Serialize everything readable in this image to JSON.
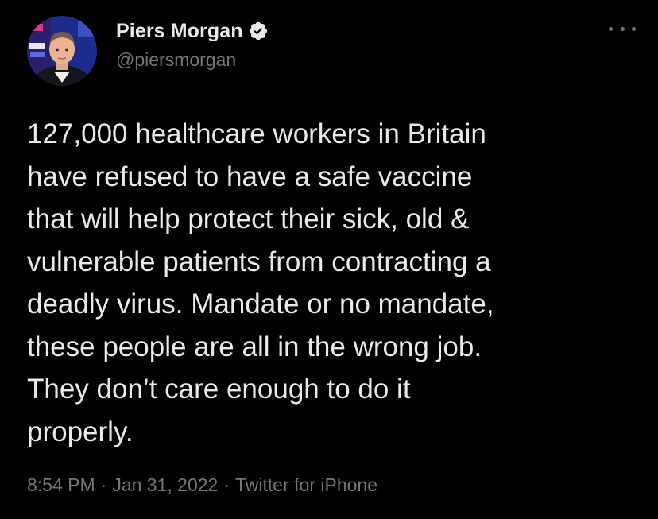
{
  "colors": {
    "background": "#000000",
    "text_primary": "#e7e9ea",
    "text_secondary": "#71767b",
    "verified_badge": "#e7e9ea"
  },
  "author": {
    "display_name": "Piers Morgan",
    "handle": "@piersmorgan",
    "verified": true,
    "avatar_icon": "profile-photo",
    "verified_icon": "verified-badge-icon"
  },
  "tweet": {
    "lines": [
      "127,000 healthcare workers in Britain",
      "have refused to have a safe vaccine",
      "that will help protect their sick, old &",
      "vulnerable patients from contracting a",
      "deadly virus. Mandate or no mandate,",
      "these people are all in the wrong job.",
      "They don’t care enough to do it",
      "properly."
    ],
    "time": "8:54 PM",
    "date": "Jan 31, 2022",
    "source": "Twitter for iPhone",
    "separator": "·"
  },
  "menu": {
    "icon": "more-options-icon"
  }
}
